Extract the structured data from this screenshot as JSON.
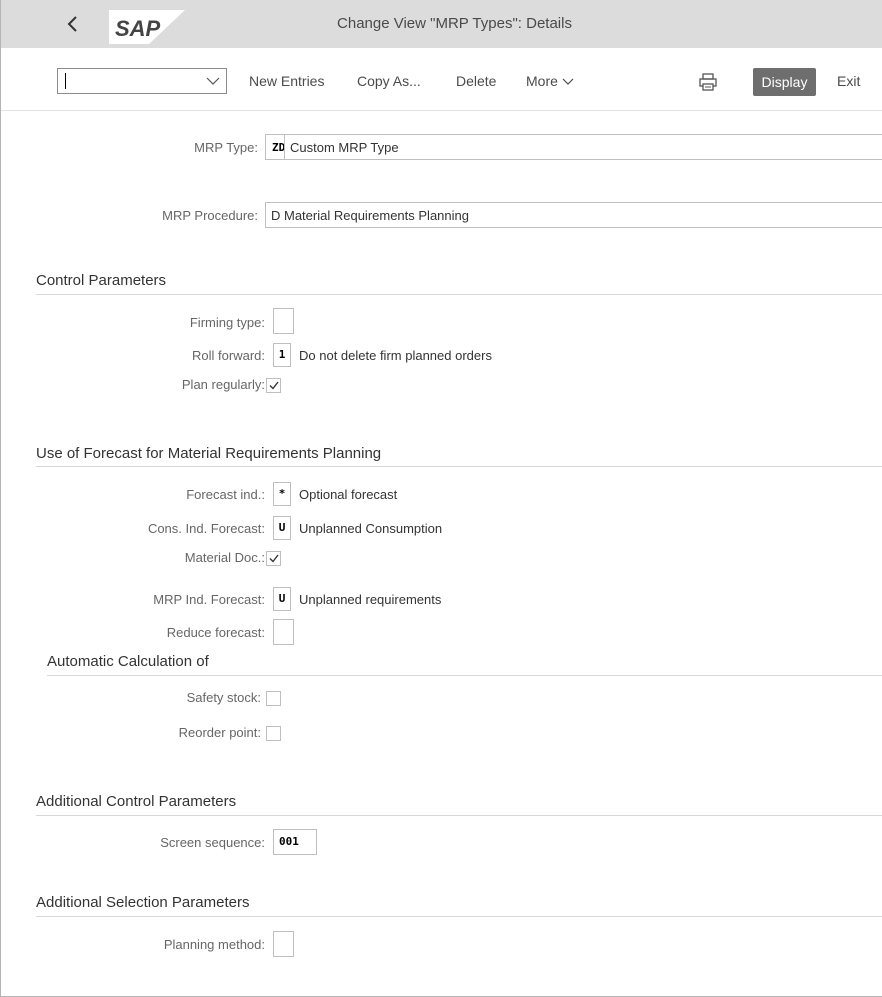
{
  "window": {
    "title": "Change View \"MRP Types\": Details"
  },
  "header": {
    "back_icon": "chevron-left-icon",
    "logo_text": "SAP"
  },
  "toolbar": {
    "command_field_value": "",
    "new_entries": "New Entries",
    "copy_as": "Copy As...",
    "delete": "Delete",
    "more": "More",
    "print_icon": "printer-icon",
    "display": "Display",
    "exit": "Exit"
  },
  "form": {
    "mrp_type": {
      "label": "MRP Type:",
      "code": "ZD",
      "value": "Custom MRP Type"
    },
    "mrp_procedure": {
      "label": "MRP Procedure:",
      "value": "D Material Requirements Planning"
    },
    "control_parameters": {
      "title": "Control Parameters",
      "firming_type": {
        "label": "Firming type:",
        "value": ""
      },
      "roll_forward": {
        "label": "Roll forward:",
        "code": "1",
        "description": "Do not delete firm planned orders"
      },
      "plan_regularly": {
        "label": "Plan regularly:",
        "checked": true
      }
    },
    "forecast": {
      "title": "Use of Forecast for Material Requirements Planning",
      "forecast_ind": {
        "label": "Forecast ind.:",
        "code": "*",
        "description": "Optional forecast"
      },
      "cons_ind_forecast": {
        "label": "Cons. Ind. Forecast:",
        "code": "U",
        "description": "Unplanned Consumption"
      },
      "material_doc": {
        "label": "Material Doc.:",
        "checked": true
      },
      "mrp_ind_forecast": {
        "label": "MRP Ind. Forecast:",
        "code": "U",
        "description": "Unplanned requirements"
      },
      "reduce_forecast": {
        "label": "Reduce forecast:",
        "value": ""
      }
    },
    "automatic_calculation": {
      "title": "Automatic Calculation of",
      "safety_stock": {
        "label": "Safety stock:",
        "checked": false
      },
      "reorder_point": {
        "label": "Reorder point:",
        "checked": false
      }
    },
    "additional_control": {
      "title": "Additional Control Parameters",
      "screen_sequence": {
        "label": "Screen sequence:",
        "value": "001"
      }
    },
    "additional_selection": {
      "title": "Additional Selection Parameters",
      "planning_method": {
        "label": "Planning method:",
        "value": ""
      }
    }
  },
  "colors": {
    "header_bg": "#dcdcdc",
    "display_button_bg": "#6e6e6e",
    "text": "#333333",
    "label": "#666666"
  }
}
